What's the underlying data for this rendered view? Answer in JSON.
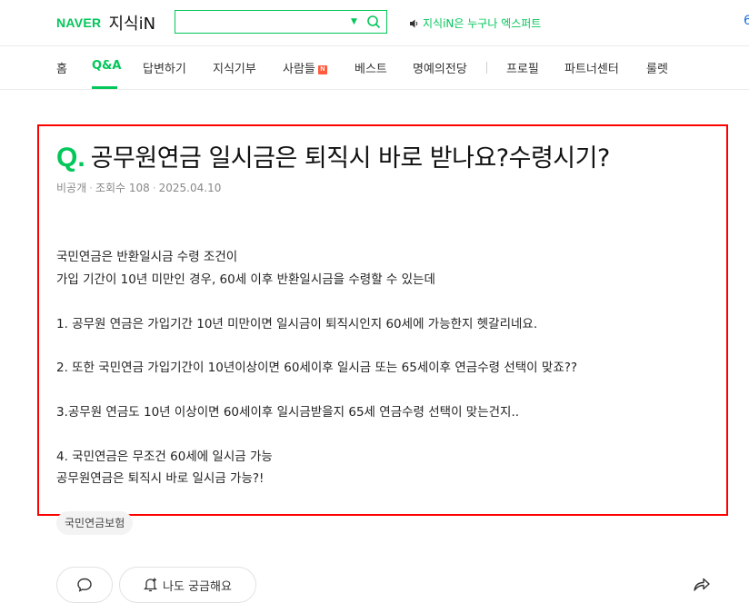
{
  "header": {
    "logo_brand": "NAVER",
    "logo_service": "지식iN",
    "search_value": "",
    "slogan": "지식iN은 누구나 엑스퍼트",
    "edge_char": "6"
  },
  "nav": {
    "items": [
      {
        "label": "홈",
        "active": false
      },
      {
        "label": "Q&A",
        "active": true
      },
      {
        "label": "답변하기",
        "active": false
      },
      {
        "label": "지식기부",
        "active": false
      },
      {
        "label": "사람들",
        "active": false,
        "badge": "N"
      },
      {
        "label": "베스트",
        "active": false
      },
      {
        "label": "명예의전당",
        "active": false
      },
      {
        "label": "프로필",
        "active": false
      },
      {
        "label": "파트너센터",
        "active": false
      },
      {
        "label": "룰렛",
        "active": false
      }
    ]
  },
  "question": {
    "q_mark": "Q.",
    "title": "공무원연금 일시금은 퇴직시 바로 받나요?수령시기?",
    "author": "비공개",
    "views": "조회수 108",
    "date": "2025.04.10",
    "body": [
      "국민연금은 반환일시금 수령 조건이",
      "가입 기간이 10년 미만인 경우, 60세 이후 반환일시금을 수령할 수 있는데",
      "1. 공무원 연금은 가입기간 10년 미만이면 일시금이 퇴직시인지 60세에 가능한지 헷갈리네요.",
      "2. 또한 국민연금 가입기간이 10년이상이면 60세이후 일시금 또는 65세이후 연금수령 선택이 맞죠??",
      "3.공무원 연금도 10년 이상이면 60세이후 일시금받을지 65세 연금수령 선택이 맞는건지..",
      "4. 국민연금은 무조건 60세에 일시금 가능",
      "공무원연금은 퇴직시 바로 일시금 가능?!"
    ],
    "tag": "국민연금보험"
  },
  "actions": {
    "curious_label": "나도 궁금해요"
  },
  "colors": {
    "brand_green": "#03c75a",
    "highlight_box": "#ff0000",
    "badge_new": "#ff5a3c"
  }
}
